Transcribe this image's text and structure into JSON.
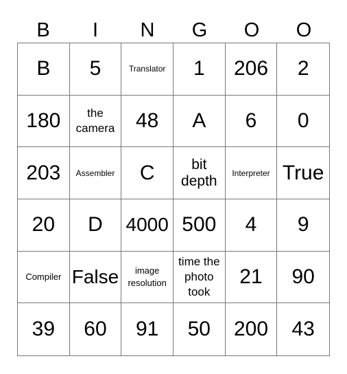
{
  "header": [
    "B",
    "I",
    "N",
    "G",
    "O",
    "O"
  ],
  "board": [
    [
      {
        "text": "B",
        "size": "xl"
      },
      {
        "text": "5",
        "size": "xl"
      },
      {
        "text": "Translator",
        "size": "xxs"
      },
      {
        "text": "1",
        "size": "xl"
      },
      {
        "text": "206",
        "size": "xl"
      },
      {
        "text": "2",
        "size": "xl"
      }
    ],
    [
      {
        "text": "180",
        "size": "xl"
      },
      {
        "text": "the camera",
        "size": "sm"
      },
      {
        "text": "48",
        "size": "xl"
      },
      {
        "text": "A",
        "size": "xl"
      },
      {
        "text": "6",
        "size": "xl"
      },
      {
        "text": "0",
        "size": "xl"
      }
    ],
    [
      {
        "text": "203",
        "size": "xl"
      },
      {
        "text": "Assembler",
        "size": "xxs"
      },
      {
        "text": "C",
        "size": "xl"
      },
      {
        "text": "bit depth",
        "size": "md"
      },
      {
        "text": "Interpreter",
        "size": "xxs"
      },
      {
        "text": "True",
        "size": "xl"
      }
    ],
    [
      {
        "text": "20",
        "size": "xl"
      },
      {
        "text": "D",
        "size": "xl"
      },
      {
        "text": "4000",
        "size": "lg"
      },
      {
        "text": "500",
        "size": "xl"
      },
      {
        "text": "4",
        "size": "xl"
      },
      {
        "text": "9",
        "size": "xl"
      }
    ],
    [
      {
        "text": "Compiler",
        "size": "xs"
      },
      {
        "text": "False",
        "size": "lg"
      },
      {
        "text": "image resolution",
        "size": "xs"
      },
      {
        "text": "time the photo took",
        "size": "sm"
      },
      {
        "text": "21",
        "size": "xl"
      },
      {
        "text": "90",
        "size": "xl"
      }
    ],
    [
      {
        "text": "39",
        "size": "xl"
      },
      {
        "text": "60",
        "size": "xl"
      },
      {
        "text": "91",
        "size": "xl"
      },
      {
        "text": "50",
        "size": "xl"
      },
      {
        "text": "200",
        "size": "xl"
      },
      {
        "text": "43",
        "size": "xl"
      }
    ]
  ]
}
